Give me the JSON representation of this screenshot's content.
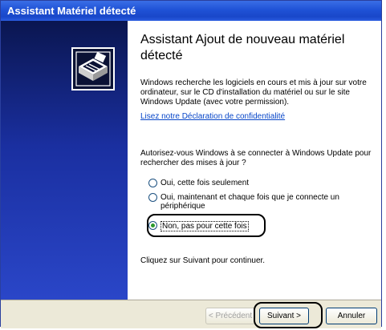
{
  "window": {
    "title": "Assistant Matériel détecté"
  },
  "content": {
    "heading": "Assistant Ajout de nouveau matériel détecté",
    "intro": "Windows recherche les logiciels en cours et mis à jour sur votre ordinateur, sur le CD d'installation du matériel ou sur le site Windows Update (avec votre permission).",
    "privacy_link": "Lisez notre Déclaration de confidentialité",
    "question": "Autorisez-vous Windows à se connecter à Windows Update pour rechercher des mises à jour ?",
    "options": [
      {
        "label": "Oui, cette fois seulement",
        "checked": false
      },
      {
        "label": "Oui, maintenant et chaque fois que je connecte un périphérique",
        "checked": false
      },
      {
        "label": "Non, pas pour cette fois",
        "checked": true
      }
    ],
    "continue_hint": "Cliquez sur Suivant pour continuer."
  },
  "buttons": {
    "back": "< Précédent",
    "next": "Suivant >",
    "cancel": "Annuler"
  },
  "icon": "hardware-wizard-icon"
}
